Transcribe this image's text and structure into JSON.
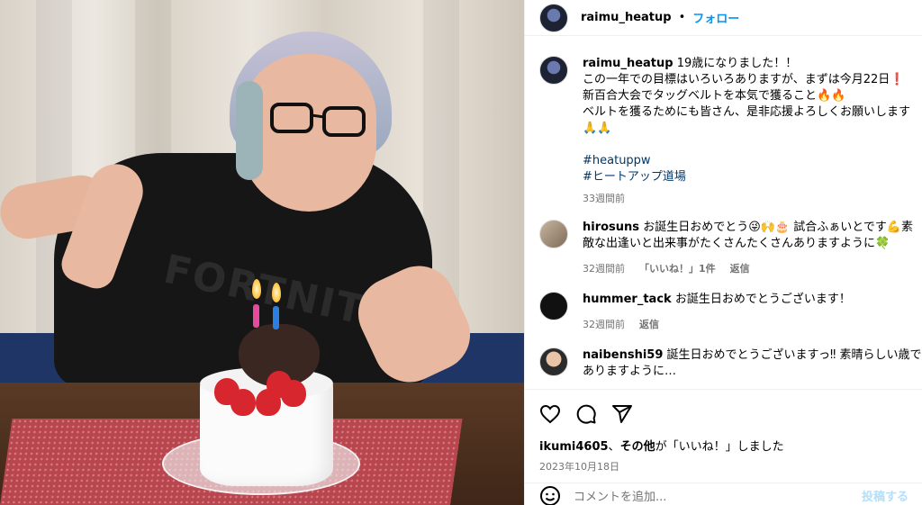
{
  "header": {
    "username": "raimu_heatup",
    "dot": "•",
    "follow_label": "フォロー"
  },
  "photo": {
    "shirt_text": "FORTNITE"
  },
  "caption": {
    "username": "raimu_heatup",
    "line1": "19歳になりました！！",
    "line2": "この一年での目標はいろいろありますが、まずは今月22日❗",
    "line3": "新百合大会でタッグベルトを本気で獲ること🔥🔥",
    "line4": "ベルトを獲るためにも皆さん、是非応援よろしくお願いします",
    "line5": "🙏🙏",
    "hashtag1": "#heatuppw",
    "hashtag2": "#ヒートアップ道場",
    "time": "33週間前"
  },
  "comments": [
    {
      "username": "hirosuns",
      "text": "お誕生日おめでとう😜🙌🎂 試合ふぁいとです💪素敵な出逢いと出来事がたくさんたくさんありますように🍀",
      "time": "32週間前",
      "likes": "「いいね！」1件",
      "reply": "返信"
    },
    {
      "username": "hummer_tack",
      "text": "お誕生日おめでとうございます！",
      "time": "32週間前",
      "reply": "返信"
    },
    {
      "username": "naibenshi59",
      "text": "誕生日おめでとうございますっ‼ 素晴らしい歳でありますように…"
    }
  ],
  "actions": {
    "liked_by_user": "ikumi4605",
    "liked_by_sep": "、",
    "liked_by_others": "その他",
    "liked_by_suffix": "が「いいね！」しました",
    "date": "2023年10月18日"
  },
  "add_comment": {
    "placeholder": "コメントを追加...",
    "post_label": "投稿する"
  }
}
